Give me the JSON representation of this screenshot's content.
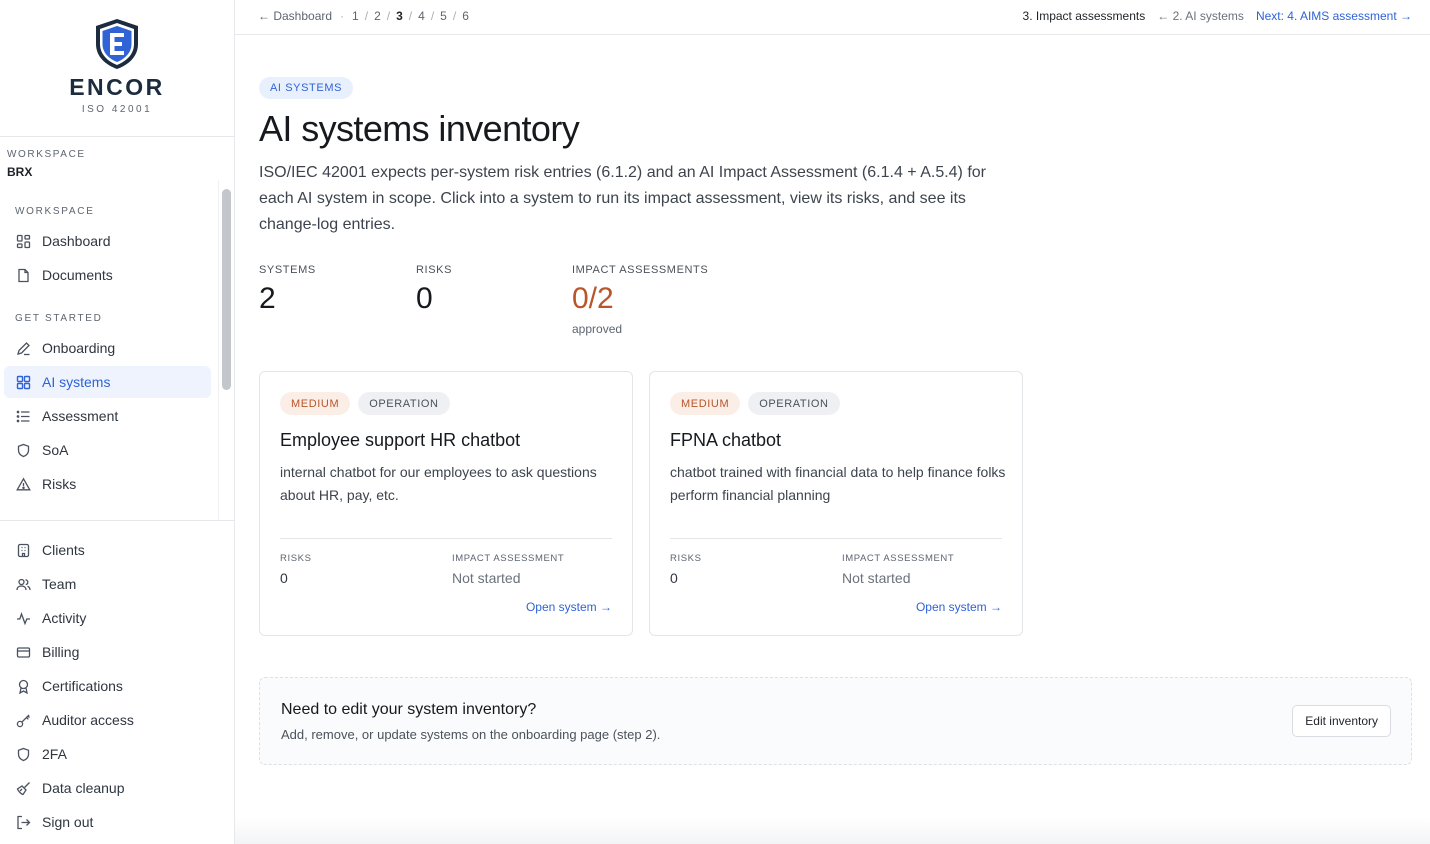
{
  "brand": {
    "name": "ENCOR",
    "subtitle": "ISO 42001"
  },
  "workspace": {
    "label": "WORKSPACE",
    "value": "BRX"
  },
  "sidebar": {
    "sections": [
      {
        "label": "WORKSPACE"
      },
      {
        "label": "GET STARTED"
      }
    ],
    "workspace_items": [
      {
        "label": "Dashboard",
        "icon": "dashboard-grid-icon"
      },
      {
        "label": "Documents",
        "icon": "document-icon"
      }
    ],
    "get_started_items": [
      {
        "label": "Onboarding",
        "icon": "pen-icon"
      },
      {
        "label": "AI systems",
        "icon": "grid-icon",
        "active": true
      },
      {
        "label": "Assessment",
        "icon": "list-icon"
      },
      {
        "label": "SoA",
        "icon": "shield-icon"
      },
      {
        "label": "Risks",
        "icon": "warning-icon"
      }
    ],
    "account_items": [
      {
        "label": "Clients",
        "icon": "building-icon"
      },
      {
        "label": "Team",
        "icon": "users-icon"
      },
      {
        "label": "Activity",
        "icon": "activity-icon"
      },
      {
        "label": "Billing",
        "icon": "credit-card-icon"
      },
      {
        "label": "Certifications",
        "icon": "award-icon"
      },
      {
        "label": "Auditor access",
        "icon": "key-icon"
      },
      {
        "label": "2FA",
        "icon": "shield-icon"
      },
      {
        "label": "Data cleanup",
        "icon": "broom-icon"
      },
      {
        "label": "Sign out",
        "icon": "sign-out-icon"
      }
    ]
  },
  "topbar": {
    "back_label": "← Dashboard",
    "dot": "·",
    "steps": [
      "1",
      "2",
      "3",
      "4",
      "5",
      "6"
    ],
    "current_step_index": 2,
    "separator": "/",
    "current_step_label": "3. Impact assessments",
    "prev_label": "← 2. AI systems",
    "next_label": "Next: 4. AIMS assessment →"
  },
  "main": {
    "badge": "AI SYSTEMS",
    "title": "AI systems inventory",
    "description": "ISO/IEC 42001 expects per-system risk entries (6.1.2) and an AI Impact Assessment (6.1.4 + A.5.4) for each AI system in scope. Click into a system to run its impact assessment, view its risks, and see its change-log entries.",
    "stats": [
      {
        "label": "SYSTEMS",
        "value": "2"
      },
      {
        "label": "RISKS",
        "value": "0"
      },
      {
        "label": "IMPACT ASSESSMENTS",
        "value": "0/2",
        "sub": "approved"
      }
    ],
    "systems": [
      {
        "tags": [
          "MEDIUM",
          "OPERATION"
        ],
        "name": "Employee support HR chatbot",
        "description": "internal chatbot for our employees to ask questions about HR, pay, etc.",
        "risks_label": "RISKS",
        "risks_value": "0",
        "ia_label": "IMPACT ASSESSMENT",
        "ia_value": "Not started",
        "link": "Open system →"
      },
      {
        "tags": [
          "MEDIUM",
          "OPERATION"
        ],
        "name": "FPNA chatbot",
        "description": "chatbot trained with financial data to help finance folks perform financial planning",
        "risks_label": "RISKS",
        "risks_value": "0",
        "ia_label": "IMPACT ASSESSMENT",
        "ia_value": "Not started",
        "link": "Open system →"
      }
    ],
    "cta": {
      "title": "Need to edit your system inventory?",
      "description": "Add, remove, or update systems on the onboarding page (step 2).",
      "button": "Edit inventory"
    }
  },
  "colors": {
    "accent": "#2f63d6",
    "warning": "#b8552a",
    "active_bg": "#eef3fd"
  }
}
